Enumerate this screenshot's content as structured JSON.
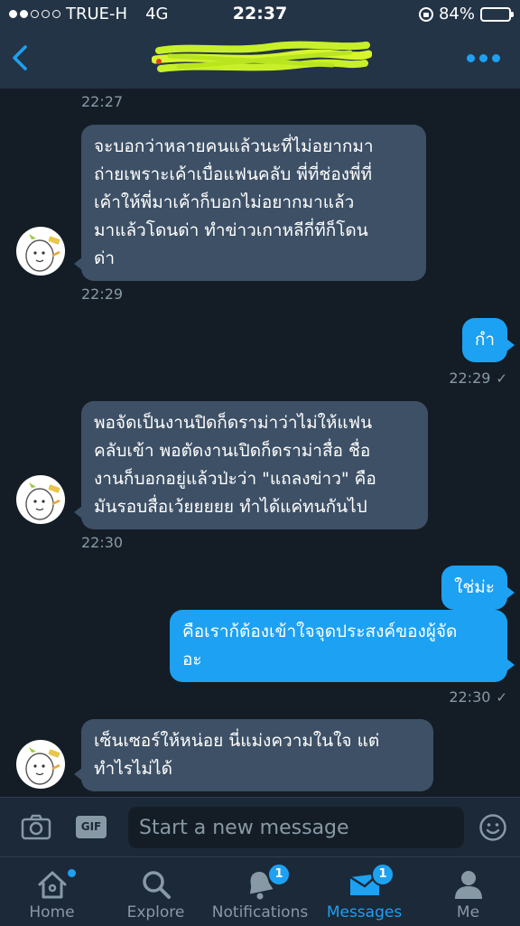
{
  "status_bar": {
    "carrier": "TRUE-H",
    "network": "4G",
    "time": "22:37",
    "battery": "84%",
    "battery_level": 0.84,
    "signal_bars_filled": 2,
    "signal_bars_total": 5
  },
  "header": {
    "back_icon": "chevron-left-icon",
    "more_icon": "more-dots-icon",
    "title_redacted": true
  },
  "messages": [
    {
      "type": "timestamp",
      "side": "in",
      "time": "22:27"
    },
    {
      "type": "message",
      "side": "in",
      "lines": [
        "จะบอกว่าหลายคนแล้วนะที่ไม่อยากมา",
        "ถ่ายเพราะเค้าเบื่อแฟนคลับ พี่ที่ช่องพี่ที่",
        "เค้าให้พี่มาเค้าก็บอกไม่อยากมาแล้ว",
        "มาแล้วโดนด่า ทำข่าวเกาหลีกี่ทีก็โดน",
        "ด่า"
      ]
    },
    {
      "type": "timestamp",
      "side": "in",
      "time": "22:29"
    },
    {
      "type": "message",
      "side": "out",
      "lines": [
        "กำ"
      ]
    },
    {
      "type": "timestamp",
      "side": "out",
      "time": "22:29"
    },
    {
      "type": "message",
      "side": "in",
      "lines": [
        "พอจัดเป็นงานปิดก็ดราม่าว่าไม่ให้แฟน",
        "คลับเข้า พอตัดงานเปิดก็ดราม่าสื่อ ชื่อ",
        "งานก็บอกอยู่แล้วป่ะว่า \"แถลงข่าว\" คือ",
        "มันรอบสื่อเว้ยยยยย ทำได้แค่ทนกันไป"
      ]
    },
    {
      "type": "timestamp",
      "side": "in",
      "time": "22:30"
    },
    {
      "type": "message",
      "side": "out",
      "lines": [
        "ใช่ม่ะ"
      ]
    },
    {
      "type": "message",
      "side": "out",
      "lines": [
        "คือเราก้ต้องเข้าใจจุดประสงค์ของผู้จัด",
        "อะ"
      ]
    },
    {
      "type": "timestamp",
      "side": "out",
      "time": "22:30"
    },
    {
      "type": "message",
      "side": "in",
      "lines": [
        "เซ็นเซอร์ให้หน่อย นี่แม่งความในใจ แต่",
        "ทำไรไม่ได้"
      ]
    }
  ],
  "composer": {
    "camera_icon": "camera-icon",
    "gif_label": "GIF",
    "placeholder": "Start a new message",
    "value": "",
    "emoji_icon": "emoji-icon"
  },
  "tabs": [
    {
      "label": "Home",
      "icon": "home-icon",
      "active": false,
      "dot": true
    },
    {
      "label": "Explore",
      "icon": "search-icon",
      "active": false
    },
    {
      "label": "Notifications",
      "icon": "bell-icon",
      "active": false,
      "badge": "1"
    },
    {
      "label": "Messages",
      "icon": "envelope-icon",
      "active": true,
      "badge": "1"
    },
    {
      "label": "Me",
      "icon": "person-icon",
      "active": false
    }
  ],
  "colors": {
    "accent": "#1da1f2",
    "background": "#141d26",
    "bar": "#243447",
    "incoming_bubble": "#3d5066",
    "battery": "#f5b418"
  }
}
